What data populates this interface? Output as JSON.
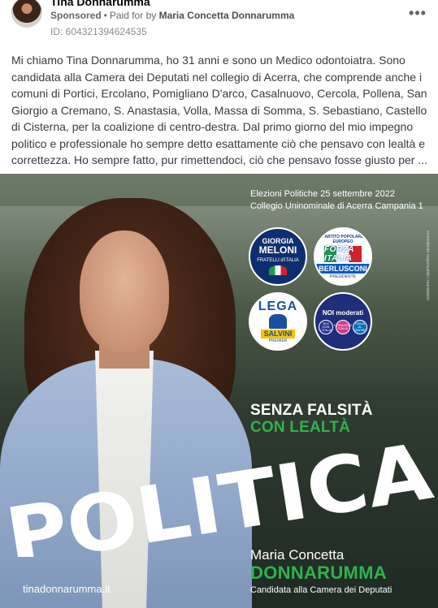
{
  "header": {
    "page_name": "Tina Donnarumma",
    "sponsored_label": "Sponsored",
    "separator": "•",
    "paid_for_prefix": "Paid for by",
    "payer": "Maria Concetta Donnarumma",
    "ad_id": "ID: 604321394624535",
    "more_icon": "more-horizontal-icon",
    "more_label": "•••"
  },
  "post": {
    "text": "Mi chiamo Tina Donnarumma, ho 31 anni e sono un Medico odontoiatra. Sono candidata alla Camera dei Deputati nel collegio di Acerra, che comprende anche i comuni di Portici, Ercolano, Pomigliano D'arco, Casalnuovo, Cercola, Pollena, San Giorgio a Cremano, S. Anastasia, Volla, Massa di Somma, S. Sebastiano, Castello di Cisterna, per la coalizione di centro-destra. Dal primo giorno del mio impegno politico e professionale ho sempre detto esattamente ciò che pensavo con lealtà e correttezza. Ho sempre fatto, pur rimettendoci, ciò che pensavo fosse giusto per ..."
  },
  "creative": {
    "election_line_1": "Elezioni Politiche 25 settembre 2022",
    "election_line_2": "Collegio Uninominale di Acerra Campania 1",
    "vertical_note": "committente responsabile / mandatario",
    "logos": {
      "fdi": {
        "top": "GIORGIA",
        "main": "MELONI",
        "sub": "FRATELLI d'ITALIA"
      },
      "fi": {
        "top": "PARTITO POPOLARE EUROPEO",
        "flag": "FORZA ITALIA",
        "name": "BERLUSCONI",
        "sub": "PRESIDENTE"
      },
      "lega": {
        "main": "LEGA",
        "name": "SALVINI",
        "sub": "PREMIER"
      },
      "nm": {
        "main": "NOI moderati",
        "dot_a": "NOI CON L'ITALIA",
        "dot_b": "CORAGGIO ITALIA",
        "dot_c": "ITALIA AL CENTRO"
      }
    },
    "slogan_1": "SENZA FALSITÀ",
    "slogan_2": "CON LEALTÀ",
    "headline": "POLITICA",
    "candidate_name": "Maria Concetta",
    "candidate_surname": "DONNARUMMA",
    "candidate_role": "Candidata alla Camera dei Deputati",
    "website": "tinadonnarumma.it"
  },
  "colors": {
    "accent_green": "#2fb34a",
    "text_secondary": "#65676b",
    "blazer_blue": "#8fa6c8"
  }
}
